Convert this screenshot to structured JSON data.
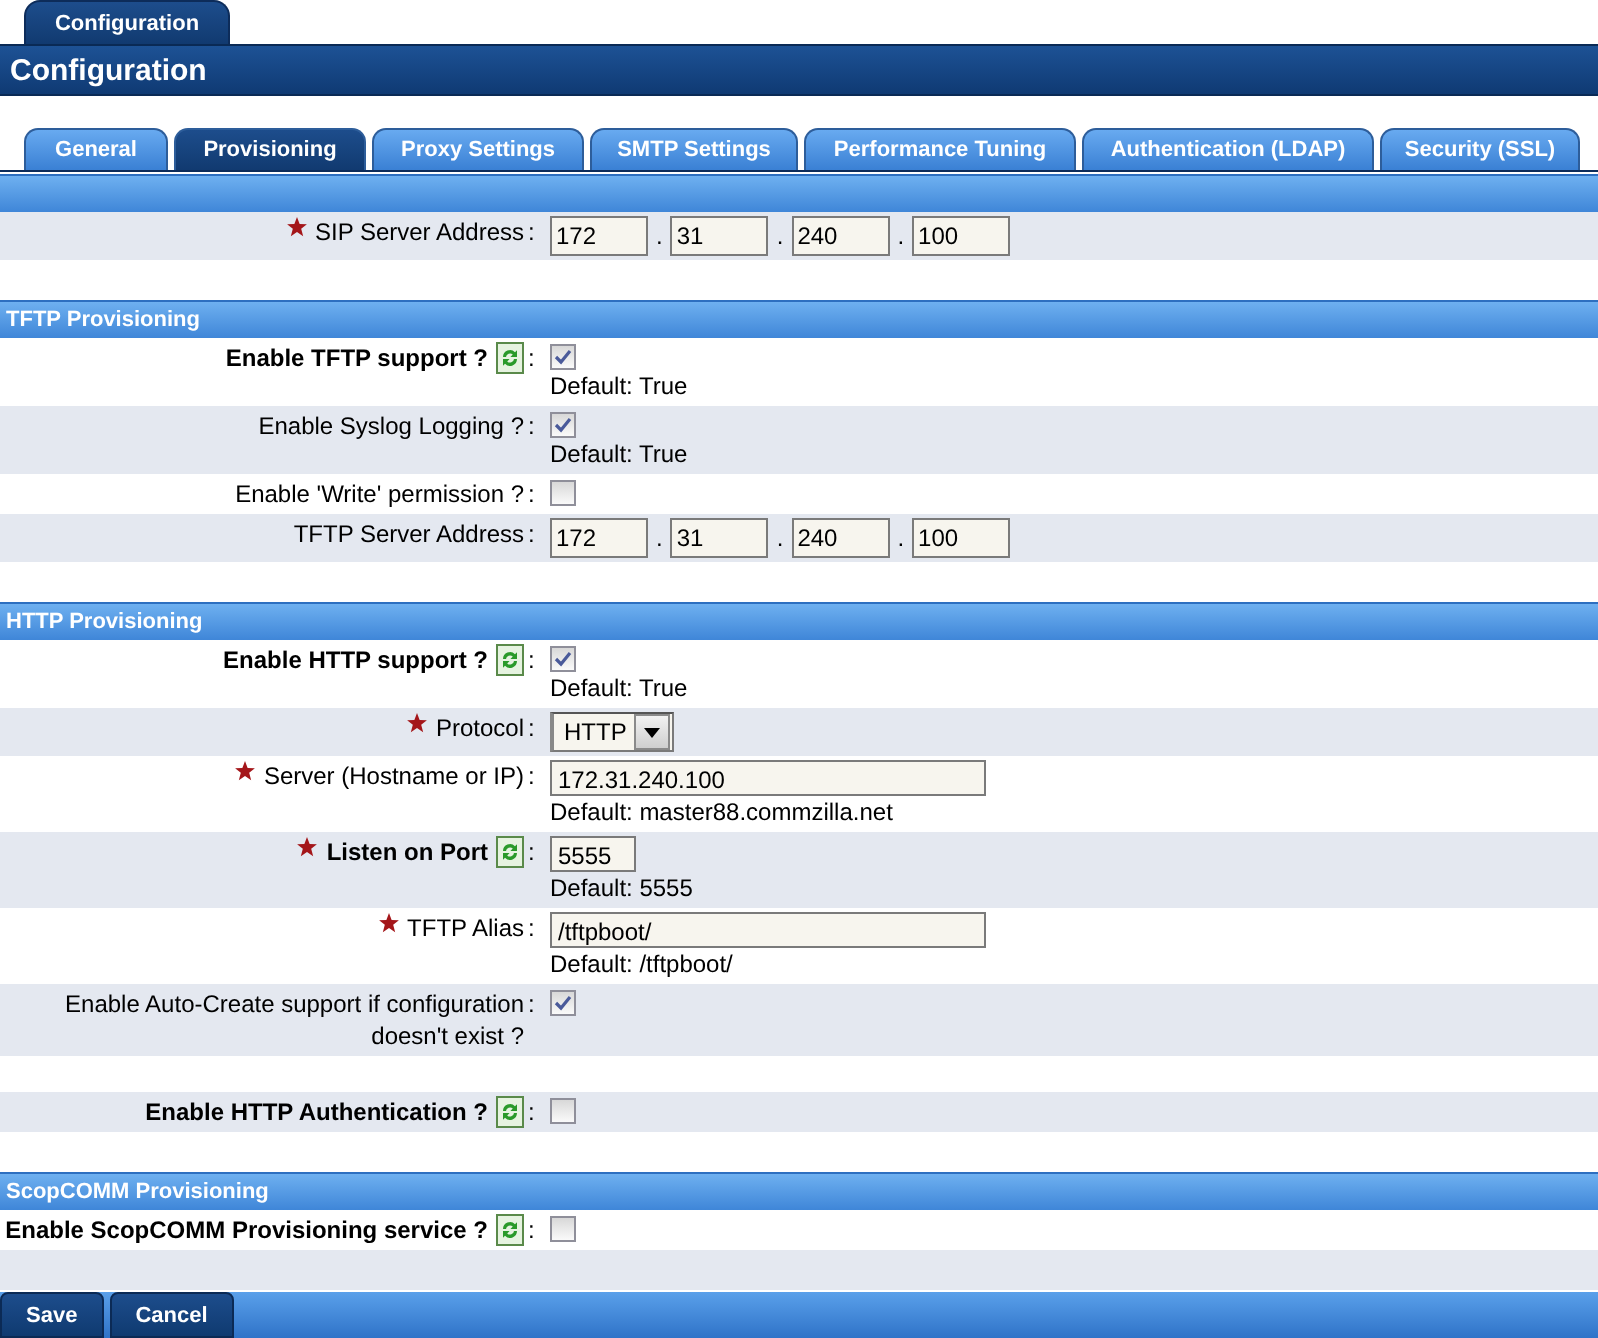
{
  "top_tab": {
    "label": "Configuration",
    "selected": true
  },
  "title": "Configuration",
  "tabs": [
    {
      "label": "General",
      "selected": false
    },
    {
      "label": "Provisioning",
      "selected": true
    },
    {
      "label": "Proxy Settings",
      "selected": false
    },
    {
      "label": "SMTP Settings",
      "selected": false
    },
    {
      "label": "Performance Tuning",
      "selected": false
    },
    {
      "label": "Authentication (LDAP)",
      "selected": false
    },
    {
      "label": "Security (SSL)",
      "selected": false
    }
  ],
  "sections": [
    {
      "rows": [
        {
          "kind": "ip",
          "label": "SIP Server Address",
          "required": true,
          "colon": ":",
          "separator": ".",
          "octets": [
            "172",
            "31",
            "240",
            "100"
          ]
        }
      ]
    },
    {
      "title": "TFTP Provisioning",
      "rows": [
        {
          "kind": "checkbox",
          "label": "Enable TFTP support ?",
          "bold": true,
          "refresh": true,
          "colon": ":",
          "checked": true,
          "default": "Default: True"
        },
        {
          "kind": "checkbox",
          "label": "Enable Syslog Logging ?",
          "colon": ":",
          "checked": true,
          "default": "Default: True"
        },
        {
          "kind": "checkbox",
          "label": "Enable 'Write' permission ?",
          "colon": ":",
          "checked": false
        },
        {
          "kind": "ip",
          "label": "TFTP Server Address",
          "colon": ":",
          "separator": ".",
          "octets": [
            "172",
            "31",
            "240",
            "100"
          ]
        }
      ]
    },
    {
      "title": "HTTP Provisioning",
      "rows": [
        {
          "kind": "checkbox",
          "label": "Enable HTTP support ?",
          "bold": true,
          "refresh": true,
          "colon": ":",
          "checked": true,
          "default": "Default: True"
        },
        {
          "kind": "select",
          "label": "Protocol",
          "required": true,
          "colon": ":",
          "value": "HTTP"
        },
        {
          "kind": "text",
          "label": "Server (Hostname or IP)",
          "required": true,
          "colon": ":",
          "value": "172.31.240.100",
          "default": "Default: master88.commzilla.net"
        },
        {
          "kind": "port",
          "label": "Listen on Port",
          "required": true,
          "bold": true,
          "refresh": true,
          "colon": ":",
          "value": "5555",
          "default": "Default: 5555"
        },
        {
          "kind": "text",
          "label": "TFTP Alias",
          "required": true,
          "colon": ":",
          "value": "/tftpboot/",
          "default": "Default: /tftpboot/"
        },
        {
          "kind": "checkbox",
          "label": "Enable Auto-Create support if configuration doesn't exist ?",
          "colon": ":",
          "checked": true
        },
        {
          "kind": "gap"
        },
        {
          "kind": "checkbox",
          "label": "Enable HTTP Authentication ?",
          "bold": true,
          "refresh": true,
          "colon": ":",
          "checked": false
        }
      ]
    },
    {
      "title": "ScopCOMM Provisioning",
      "rows": [
        {
          "kind": "checkbox",
          "label": "Enable ScopCOMM Provisioning service ?",
          "bold": true,
          "refresh": true,
          "colon": ":",
          "checked": false
        }
      ]
    }
  ],
  "buttons": [
    "Save",
    "Cancel"
  ]
}
